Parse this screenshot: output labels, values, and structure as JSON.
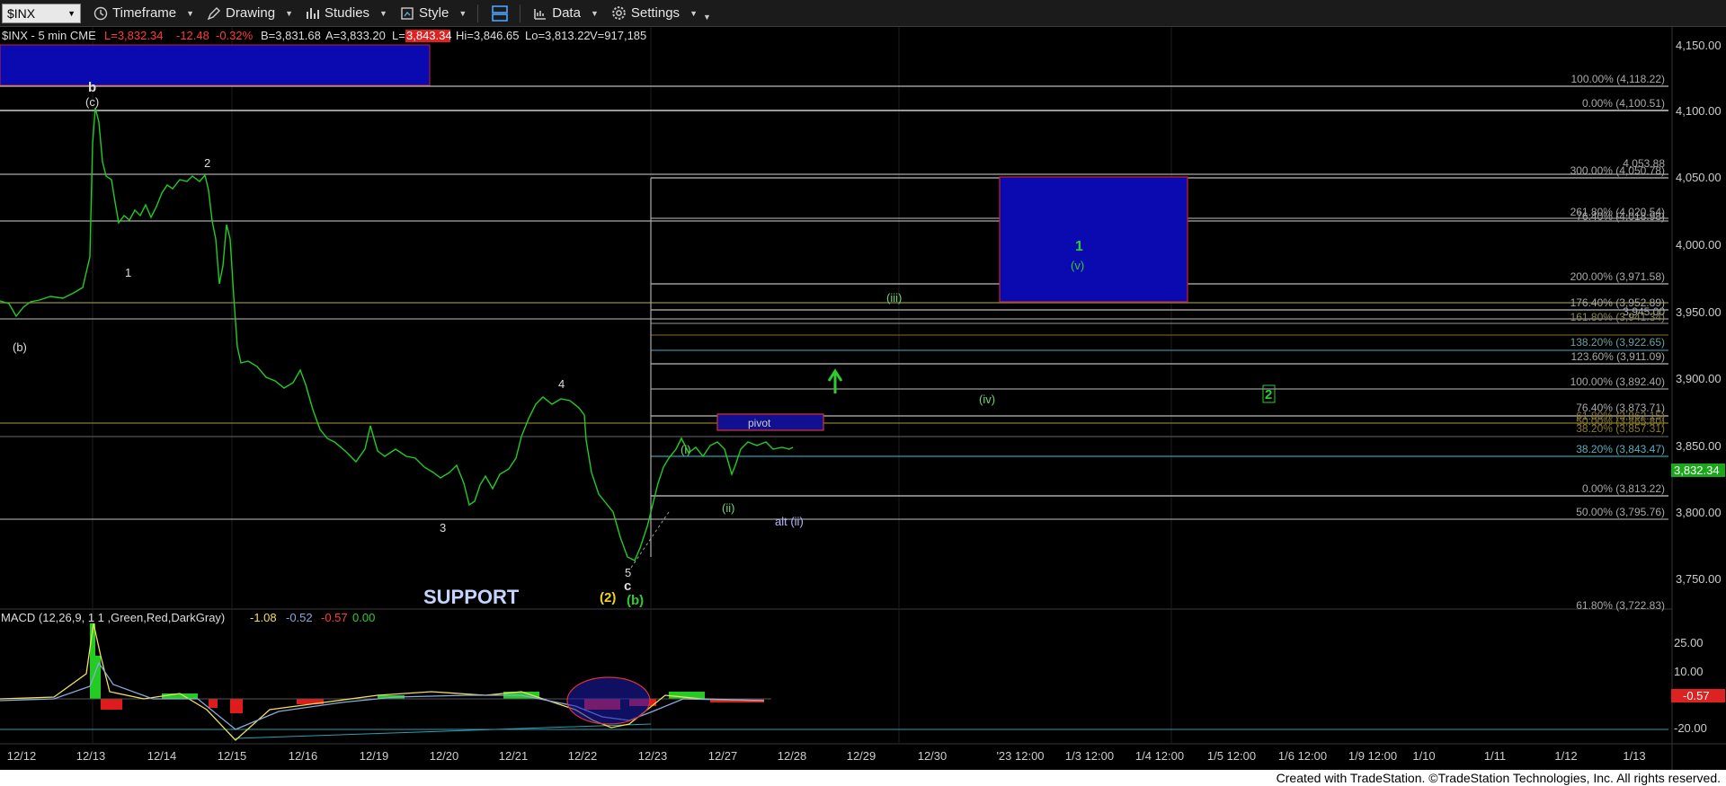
{
  "toolbar": {
    "symbol": "$INX",
    "timeframe": "Timeframe",
    "drawing": "Drawing",
    "studies": "Studies",
    "style": "Style",
    "data": "Data",
    "settings": "Settings"
  },
  "info_line": {
    "name": "$INX - 5 min  CME",
    "last": "L=3,832.34",
    "change": "-12.48",
    "pct": "-0.32%",
    "bid": "B=3,831.68",
    "ask": "A=3,833.20",
    "last_box": "3,843.34",
    "hi": "Hi=3,846.65",
    "lo": "Lo=3,813.22",
    "vol": "V=917,185"
  },
  "price_axis": {
    "ticks": [
      "4,150.00",
      "4,100.00",
      "4,050.00",
      "4,000.00",
      "3,950.00",
      "3,900.00",
      "3,850.00",
      "3,800.00",
      "3,750.00"
    ],
    "current": "3,832.34"
  },
  "macd_axis": {
    "ticks": [
      "25.00",
      "10.00",
      "-20.00"
    ],
    "current": "-0.57"
  },
  "date_axis": [
    "12/12",
    "12/13",
    "12/14",
    "12/15",
    "12/16",
    "12/19",
    "12/20",
    "12/21",
    "12/22",
    "12/23",
    "12/27",
    "12/28",
    "12/29",
    "12/30",
    "'23 12:00",
    "1/3 12:00",
    "1/4 12:00",
    "1/5 12:00",
    "1/6 12:00",
    "1/9 12:00",
    "1/10",
    "1/11",
    "1/12",
    "1/13"
  ],
  "fib_labels": [
    "100.00% (4,118.22)",
    "0.00% (4,100.51)",
    "300.00% (4,050.78)",
    "4,053.88",
    "261.80% (4,020.54)",
    "76.40% (4,018.98)",
    "200.00% (3,971.58)",
    "176.40% (3,952.89)",
    "3,945.00",
    "161.80% (3,941.34)",
    "138.20% (3,922.65)",
    "123.60% (3,911.09)",
    "100.00% (3,892.40)",
    "76.40% (3,873.71)",
    "61.80% (3,862.15)",
    "50.00% (3,865.80)",
    "38.20% (3,857.31)",
    "38.20% (3,843.47)",
    "0.00% (3,813.22)",
    "50.00% (3,795.76)",
    "61.80% (3,722.83)"
  ],
  "wave_labels": {
    "b": "b",
    "c_paren": "(c)",
    "two": "2",
    "one": "1",
    "b_paren": "(b)",
    "three": "3",
    "four": "4",
    "five": "5",
    "c": "c",
    "two_paren": "(2)",
    "b_paren_green": "(b)",
    "i": "(i)",
    "ii": "(ii)",
    "alt_ii": "alt (ii)",
    "iii": "(iii)",
    "iv": "(iv)",
    "one_green": "1",
    "v": "(v)",
    "two_green": "2",
    "pivot": "pivot",
    "support": "SUPPORT"
  },
  "macd_label": {
    "name": "MACD (12,26,9, 1  1 ,Green,Red,DarkGray)",
    "v1": "-1.08",
    "v2": "-0.52",
    "v3": "-0.57",
    "v4": "0.00"
  },
  "footer": "Created with TradeStation. ©TradeStation Technologies, Inc. All rights reserved."
}
